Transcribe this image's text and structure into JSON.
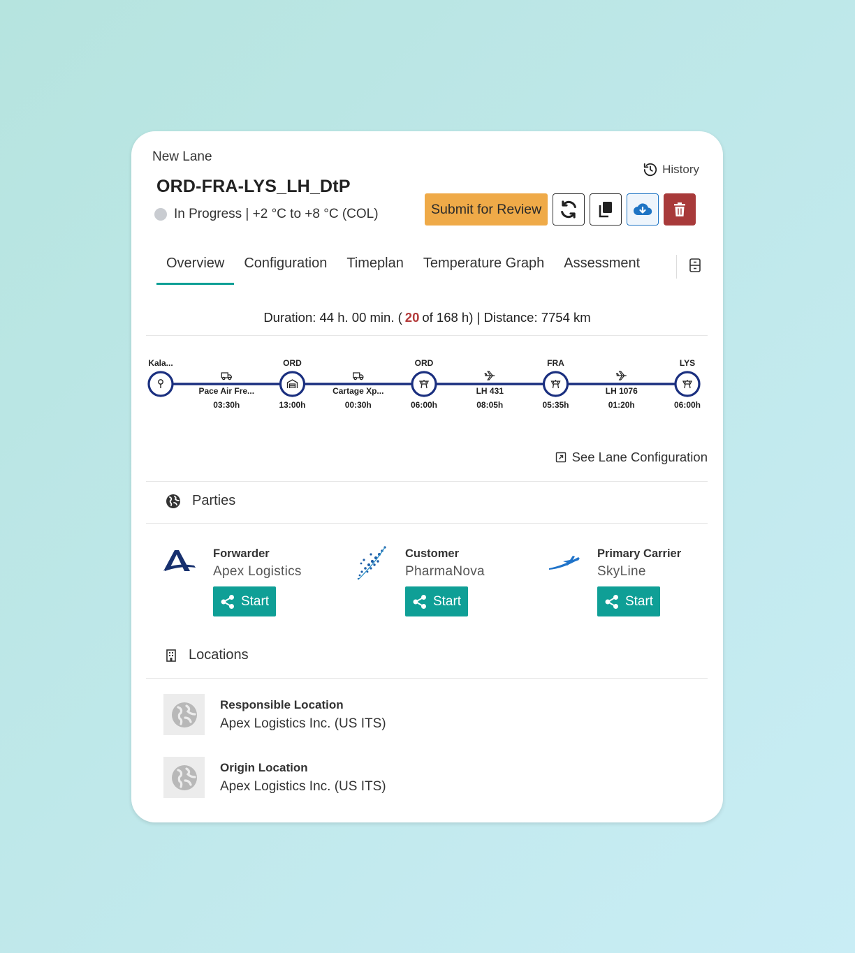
{
  "header": {
    "breadcrumb": "New Lane",
    "title": "ORD-FRA-LYS_LH_DtP",
    "status": "In Progress | +2 °C to +8 °C (COL)",
    "history_label": "History"
  },
  "toolbar": {
    "submit_label": "Submit for Review",
    "icons": [
      "refresh-icon",
      "copy-icon",
      "cloud-download-icon",
      "trash-icon"
    ]
  },
  "tabs": [
    {
      "label": "Overview",
      "active": true
    },
    {
      "label": "Configuration",
      "active": false
    },
    {
      "label": "Timeplan",
      "active": false
    },
    {
      "label": "Temperature Graph",
      "active": false
    },
    {
      "label": "Assessment",
      "active": false
    }
  ],
  "summary": {
    "prefix": "Duration: 44 h. 00 min. (",
    "highlight": "20",
    "suffix": "of 168 h) | Distance: 7754 km"
  },
  "timeline": {
    "stops": [
      {
        "code": "Kala...",
        "icon": "pin",
        "time": ""
      },
      {
        "code": "ORD",
        "icon": "warehouse",
        "time": "13:00h"
      },
      {
        "code": "ORD",
        "icon": "tower",
        "time": "06:00h"
      },
      {
        "code": "FRA",
        "icon": "tower",
        "time": "05:35h"
      },
      {
        "code": "LYS",
        "icon": "tower",
        "time": "06:00h"
      }
    ],
    "legs": [
      {
        "label": "Pace Air Fre...",
        "icon": "truck",
        "time": "03:30h"
      },
      {
        "label": "Cartage Xp...",
        "icon": "truck",
        "time": "00:30h"
      },
      {
        "label": "LH 431",
        "icon": "plane",
        "time": "08:05h"
      },
      {
        "label": "LH 1076",
        "icon": "plane",
        "time": "01:20h"
      }
    ]
  },
  "links": {
    "see_config": "See Lane Configuration"
  },
  "parties": {
    "title": "Parties",
    "items": [
      {
        "role": "Forwarder",
        "name": "Apex Logistics",
        "button": "Start"
      },
      {
        "role": "Customer",
        "name": "PharmaNova",
        "button": "Start"
      },
      {
        "role": "Primary Carrier",
        "name": "SkyLine",
        "button": "Start"
      }
    ]
  },
  "locations": {
    "title": "Locations",
    "items": [
      {
        "title": "Responsible Location",
        "value": "Apex Logistics Inc. (US ITS)"
      },
      {
        "title": "Origin Location",
        "value": "Apex Logistics Inc. (US ITS)"
      }
    ]
  },
  "colors": {
    "accent": "#0f9f96",
    "submit": "#efaa48",
    "delete": "#a83a3a",
    "timeline": "#1a2f7f",
    "highlight": "#b33a3a"
  }
}
